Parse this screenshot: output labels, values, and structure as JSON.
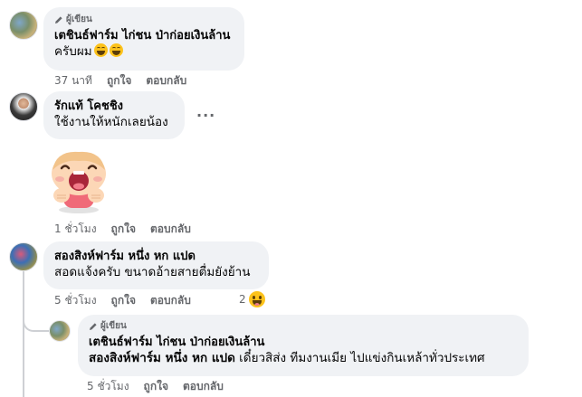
{
  "comments": [
    {
      "author_badge": "ผู้เขียน",
      "name": "เตชินธ์ฟาร์ม ไก่ชน ป่าก่อยเงินล้าน",
      "text": "ครับผม",
      "emoji": "grinning-squinting-face",
      "time": "37 นาที",
      "like": "ถูกใจ",
      "reply": "ตอบกลับ"
    },
    {
      "name": "รักแท้ โคชชิง",
      "text": "ใช้งานให้หนักเลยน้อง",
      "more": "···",
      "sticker": "laughing-cartoon-sticker",
      "time": "1 ชั่วโมง",
      "like": "ถูกใจ",
      "reply": "ตอบกลับ"
    },
    {
      "name": "สองสิงห์ฟาร์ม หนึ่ง หก แปด",
      "text": "สอดแจ้งครับ ขนาดอ้ายสายตื่มยังย้าน",
      "time": "5 ชั่วโมง",
      "like": "ถูกใจ",
      "reply": "ตอบกลับ",
      "reaction_count": "2",
      "reaction_icon": "haha-reaction"
    }
  ],
  "reply": {
    "author_badge": "ผู้เขียน",
    "name": "เตชินธ์ฟาร์ม ไก่ชน ป่าก่อยเงินล้าน",
    "mention": "สองสิงห์ฟาร์ม หนึ่ง หก แปด",
    "text": " เดี๋ยวสิส่ง ทีมงานเมีย ไปแข่งกินเหล้าทั่วประเทศ",
    "time": "5 ชั่วโมง",
    "like": "ถูกใจ",
    "reply": "ตอบกลับ"
  },
  "colors": {
    "bubble": "#f0f2f5",
    "secondary_text": "#65676b",
    "primary_text": "#050505",
    "thread_line": "#ced0d4"
  }
}
